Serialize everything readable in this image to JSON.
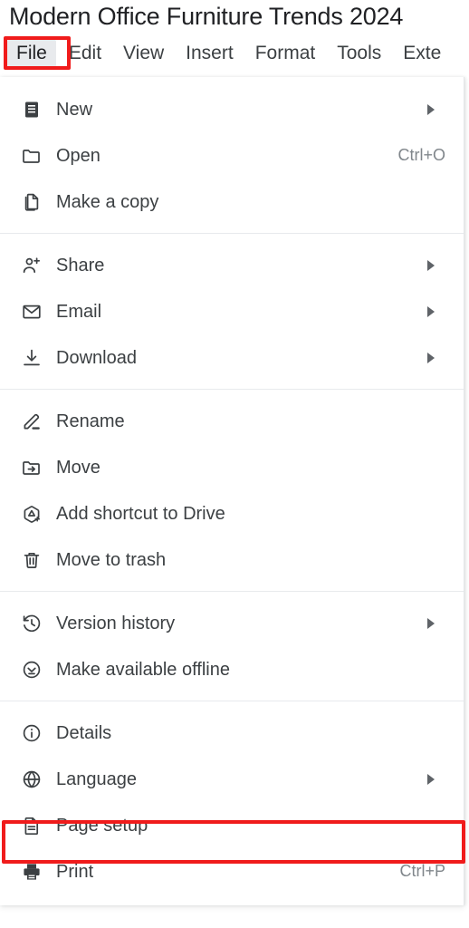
{
  "document": {
    "title": "Modern Office Furniture Trends 2024"
  },
  "menubar": {
    "items": [
      {
        "label": "File",
        "active": true
      },
      {
        "label": "Edit",
        "active": false
      },
      {
        "label": "View",
        "active": false
      },
      {
        "label": "Insert",
        "active": false
      },
      {
        "label": "Format",
        "active": false
      },
      {
        "label": "Tools",
        "active": false
      },
      {
        "label": "Exte",
        "active": false
      }
    ]
  },
  "colors": {
    "annotation_red": "#f01b1b",
    "menu_active_bg": "#e8eaed",
    "text_primary": "#3c4043",
    "text_muted": "#80868b"
  },
  "file_menu": {
    "groups": [
      {
        "items": [
          {
            "icon": "new-document-icon",
            "label": "New",
            "shortcut": "",
            "submenu": true
          },
          {
            "icon": "folder-icon",
            "label": "Open",
            "shortcut": "Ctrl+O",
            "submenu": false
          },
          {
            "icon": "copy-icon",
            "label": "Make a copy",
            "shortcut": "",
            "submenu": false
          }
        ]
      },
      {
        "items": [
          {
            "icon": "person-add-icon",
            "label": "Share",
            "shortcut": "",
            "submenu": true
          },
          {
            "icon": "envelope-icon",
            "label": "Email",
            "shortcut": "",
            "submenu": true
          },
          {
            "icon": "download-icon",
            "label": "Download",
            "shortcut": "",
            "submenu": true
          }
        ]
      },
      {
        "items": [
          {
            "icon": "pencil-icon",
            "label": "Rename",
            "shortcut": "",
            "submenu": false
          },
          {
            "icon": "folder-move-icon",
            "label": "Move",
            "shortcut": "",
            "submenu": false
          },
          {
            "icon": "drive-shortcut-icon",
            "label": "Add shortcut to Drive",
            "shortcut": "",
            "submenu": false
          },
          {
            "icon": "trash-icon",
            "label": "Move to trash",
            "shortcut": "",
            "submenu": false
          }
        ]
      },
      {
        "items": [
          {
            "icon": "history-icon",
            "label": "Version history",
            "shortcut": "",
            "submenu": true
          },
          {
            "icon": "check-circle-icon",
            "label": "Make available offline",
            "shortcut": "",
            "submenu": false
          }
        ]
      },
      {
        "items": [
          {
            "icon": "info-icon",
            "label": "Details",
            "shortcut": "",
            "submenu": false
          },
          {
            "icon": "globe-icon",
            "label": "Language",
            "shortcut": "",
            "submenu": true
          },
          {
            "icon": "page-setup-icon",
            "label": "Page setup",
            "shortcut": "",
            "submenu": false,
            "highlighted": true
          },
          {
            "icon": "printer-icon",
            "label": "Print",
            "shortcut": "Ctrl+P",
            "submenu": false
          }
        ]
      }
    ]
  }
}
